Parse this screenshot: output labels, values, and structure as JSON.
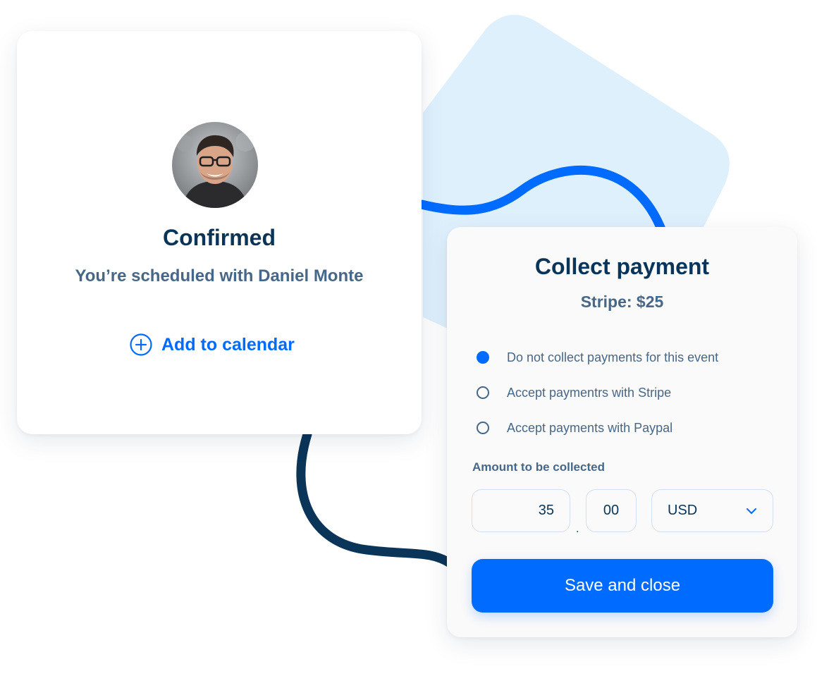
{
  "confirmation": {
    "title": "Confirmed",
    "subtitle": "You’re scheduled with Daniel Monte",
    "add_calendar_label": "Add to calendar"
  },
  "payment": {
    "title": "Collect payment",
    "subtitle": "Stripe: $25",
    "options": [
      {
        "label": "Do not collect payments for this event",
        "selected": true
      },
      {
        "label": "Accept paymentrs with Stripe",
        "selected": false
      },
      {
        "label": "Accept payments with Paypal",
        "selected": false
      }
    ],
    "amount_label": "Amount to be collected",
    "amount_dollars": "35",
    "decimal_separator": ".",
    "amount_cents": "00",
    "currency": "USD",
    "save_label": "Save and close"
  },
  "icons": {
    "add_calendar": "plus-circle-icon",
    "currency_dropdown": "chevron-down-icon"
  },
  "colors": {
    "accent": "#006bff",
    "heading": "#0b3558",
    "text": "#476788",
    "wave_light": "#006bff",
    "wave_dark": "#0b3558",
    "backdrop": "#dff0fd"
  }
}
